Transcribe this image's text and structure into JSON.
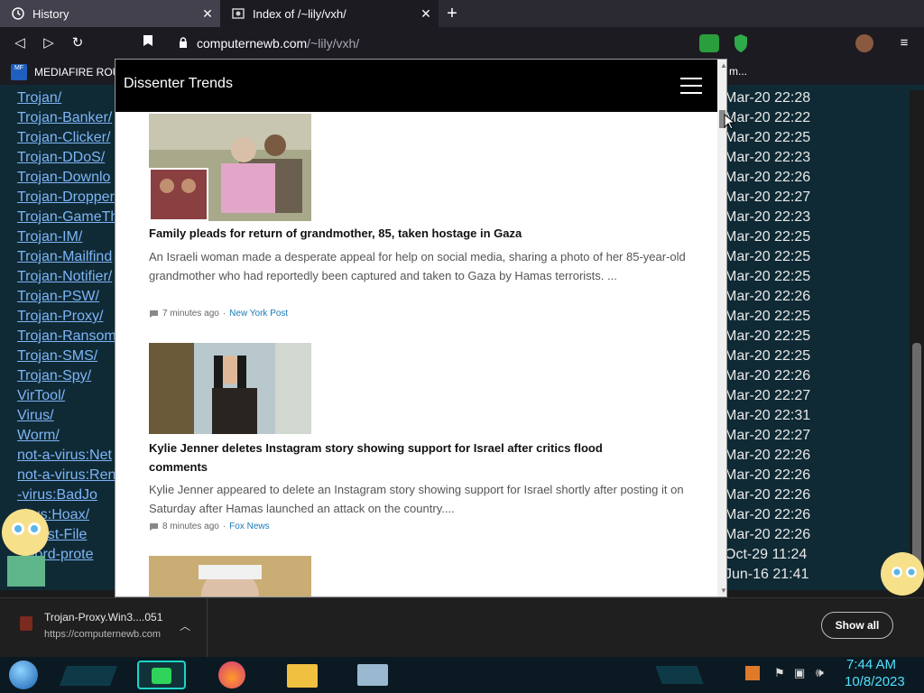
{
  "tabs": [
    {
      "label": "History"
    },
    {
      "label": "Index of /~lily/vxh/"
    }
  ],
  "address": {
    "host": "computernewb.com",
    "path": "/~lily/vxh/"
  },
  "bookmarks": [
    {
      "label": "MEDIAFIRE ROU",
      "badge": "MF"
    }
  ],
  "bg_page": {
    "links": [
      "Trojan/",
      "Trojan-Banker/",
      "Trojan-Clicker/",
      "Trojan-DDoS/",
      "Trojan-Downlo",
      "Trojan-Dropper",
      "Trojan-GameTh",
      "Trojan-IM/",
      "Trojan-Mailfind",
      "Trojan-Notifier/",
      "Trojan-PSW/",
      "Trojan-Proxy/",
      "Trojan-Ransom",
      "Trojan-SMS/",
      "Trojan-Spy/",
      "VirTool/",
      "Virus/",
      "Worm/",
      "not-a-virus:Net",
      "not-a-virus:Ren",
      "-virus:BadJo",
      "virus:Hoax/",
      "R-Test-File",
      "sword-prote"
    ],
    "dates": [
      "Mar-20 22:28",
      "Mar-20 22:22",
      "Mar-20 22:25",
      "Mar-20 22:23",
      "Mar-20 22:26",
      "Mar-20 22:27",
      "Mar-20 22:23",
      "Mar-20 22:25",
      "Mar-20 22:25",
      "Mar-20 22:25",
      "Mar-20 22:26",
      "Mar-20 22:25",
      "Mar-20 22:25",
      "Mar-20 22:25",
      "Mar-20 22:26",
      "Mar-20 22:27",
      "Mar-20 22:31",
      "Mar-20 22:27",
      "Mar-20 22:26",
      "Mar-20 22:26",
      "Mar-20 22:26",
      "Mar-20 22:26",
      "Mar-20 22:26",
      "Oct-29 11:24",
      "Jun-16 21:41"
    ],
    "overflow_label": "m..."
  },
  "popup": {
    "title": "Dissenter Trends",
    "articles": [
      {
        "title": "Family pleads for return of grandmother, 85, taken hostage in Gaza",
        "desc": "An Israeli woman made a desperate appeal for help on social media, sharing a photo of her 85-year-old grandmother who had reportedly been captured and taken to Gaza by Hamas terrorists. ...",
        "time": "7 minutes ago",
        "source": "New York Post"
      },
      {
        "title": "Kylie Jenner deletes Instagram story showing support for Israel after critics flood comments",
        "desc": "Kylie Jenner appeared to delete an Instagram story showing support for Israel shortly after posting it on Saturday after Hamas launched an attack on the country....",
        "time": "8 minutes ago",
        "source": "Fox News"
      }
    ]
  },
  "download": {
    "name": "Trojan-Proxy.Win3....051",
    "url": "https://computernewb.com",
    "show_all": "Show all"
  },
  "clock": {
    "time": "7:44 AM",
    "date": "10/8/2023"
  },
  "colors": {
    "accent": "#4fe0ff",
    "link": "#7fb4f5",
    "source": "#1a7bb8"
  }
}
